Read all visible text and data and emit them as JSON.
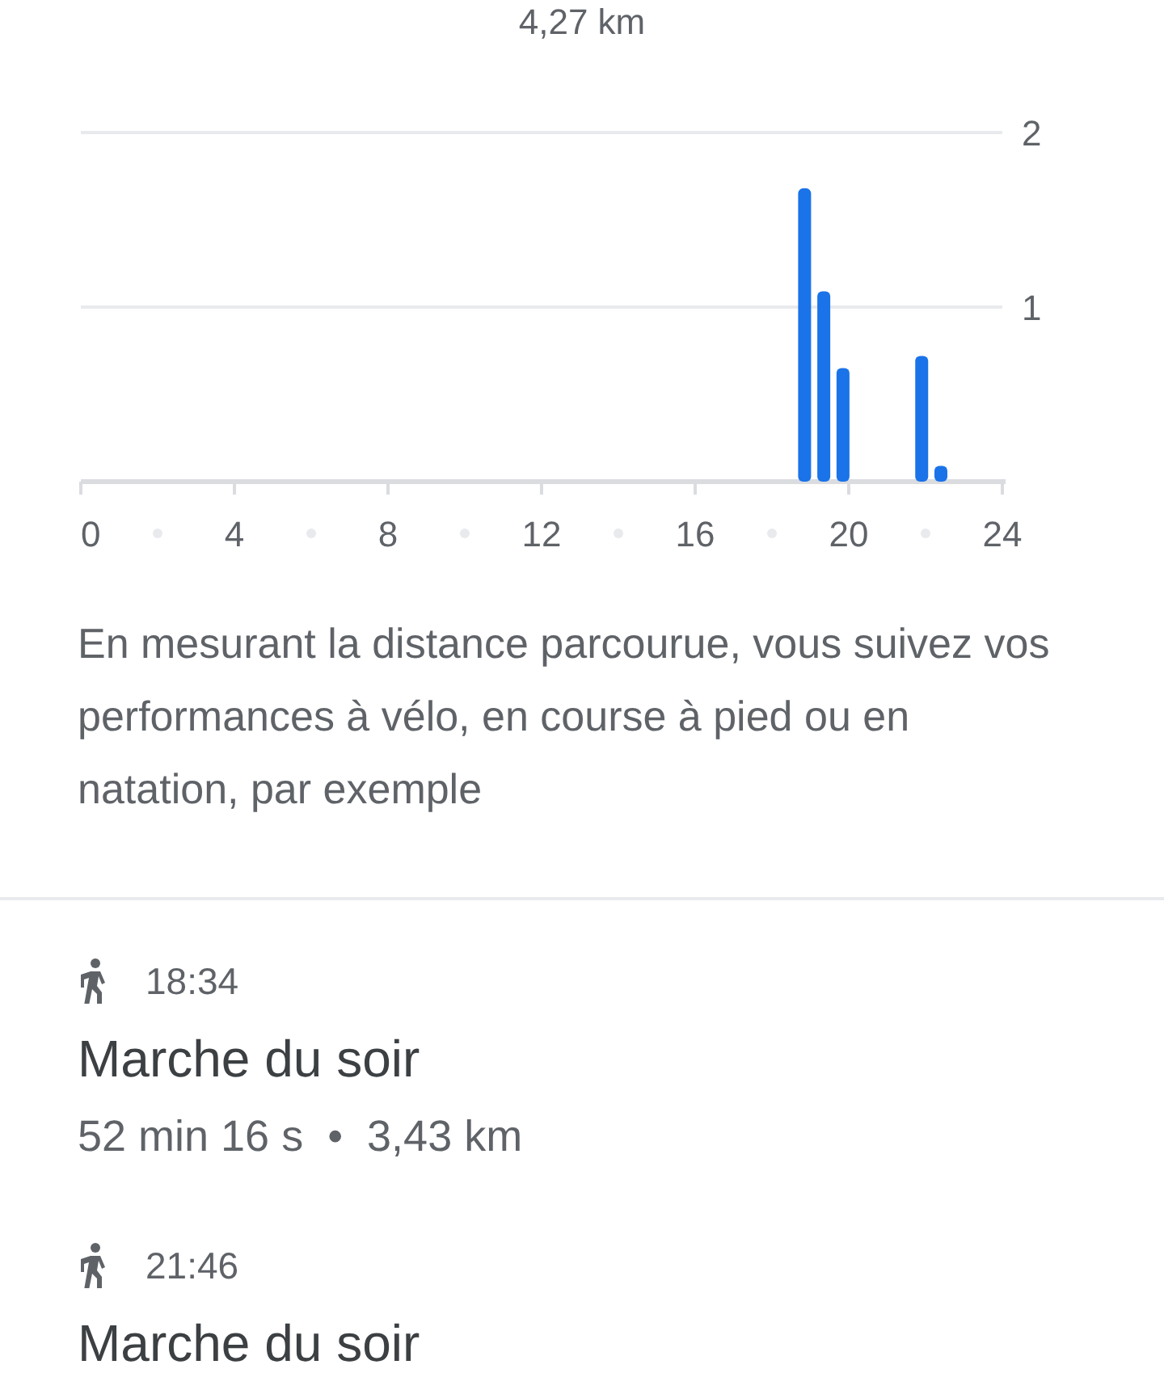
{
  "total_distance": "4,27 km",
  "chart_data": {
    "type": "bar",
    "x": [
      18.85,
      19.35,
      19.85,
      21.9,
      22.4
    ],
    "series": [
      {
        "color": "#1a73e8",
        "values": [
          1.68,
          1.09,
          0.65,
          0.72,
          0.09
        ]
      }
    ],
    "xlim": [
      0,
      24
    ],
    "ylim": [
      0,
      2
    ],
    "xticks": [
      0,
      4,
      8,
      12,
      16,
      20,
      24
    ],
    "yticks": [
      1,
      2
    ]
  },
  "description": "En mesurant la distance parcourue, vous suivez vos performances à vélo, en course à pied ou en natation, par exemple",
  "activities": [
    {
      "kind": "walk",
      "time": "18:34",
      "title": "Marche du soir",
      "stats": "52 min 16 s  •  3,43 km"
    },
    {
      "kind": "walk",
      "time": "21:46",
      "title": "Marche du soir"
    }
  ]
}
